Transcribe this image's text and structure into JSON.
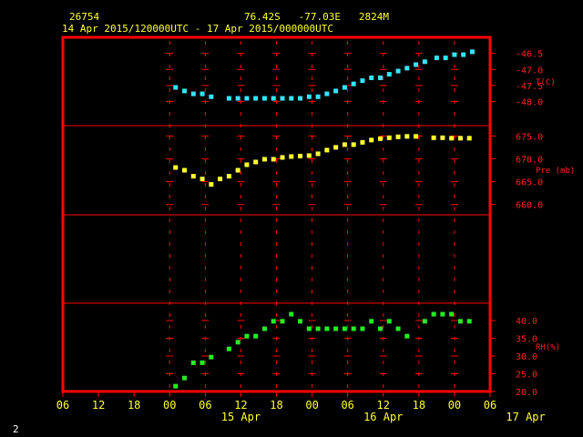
{
  "header": {
    "station": "26754",
    "location": "76.42S   -77.03E   2824M",
    "period": "14 Apr 2015/120000UTC - 17 Apr 2015/000000UTC"
  },
  "footer_label": "2",
  "colors": {
    "frame": "#ff0000",
    "axis_text": "#ffff33",
    "right_labels": "#ff2020",
    "temperature": "#33e5ff",
    "pressure": "#ffff33",
    "rh": "#22ee22",
    "background": "#000000"
  },
  "chart_data": [
    {
      "type": "scatter",
      "name": "temperature",
      "ylabel": "T(C)",
      "ylim": [
        -48.75,
        -46.0
      ],
      "yticks": [
        -46.5,
        -47.0,
        -47.5,
        -48.0
      ],
      "ytick_labels": [
        "-46.5",
        "-47.0",
        "-47.5",
        "-48.0"
      ],
      "x_hours": [
        13,
        14.5,
        16,
        17.5,
        19,
        22,
        23.5,
        25,
        26.5,
        28,
        29.5,
        31,
        32.5,
        34,
        35.5,
        37,
        38.5,
        40,
        41.5,
        43,
        44.5,
        46,
        47.5,
        49,
        50.5,
        52,
        53.5,
        55,
        57,
        58.5,
        60,
        61.5,
        63
      ],
      "values": [
        -47.56,
        -47.67,
        -47.76,
        -47.76,
        -47.85,
        -47.9,
        -47.9,
        -47.9,
        -47.9,
        -47.9,
        -47.9,
        -47.9,
        -47.9,
        -47.9,
        -47.85,
        -47.85,
        -47.76,
        -47.67,
        -47.56,
        -47.45,
        -47.35,
        -47.26,
        -47.26,
        -47.15,
        -47.05,
        -46.96,
        -46.85,
        -46.76,
        -46.64,
        -46.64,
        -46.54,
        -46.54,
        -46.45
      ]
    },
    {
      "type": "scatter",
      "name": "pressure",
      "ylabel": "Pre (mb)",
      "ylim": [
        657.75,
        677.25
      ],
      "yticks": [
        675.0,
        670.0,
        665.0,
        660.0
      ],
      "ytick_labels": [
        "675.0",
        "670.0",
        "665.0",
        "660.0"
      ],
      "x_hours": [
        13,
        14.5,
        16,
        17.5,
        19,
        20.5,
        22,
        23.5,
        25,
        26.5,
        28,
        29.5,
        31,
        32.5,
        34,
        35.5,
        37,
        38.5,
        40,
        41.5,
        43,
        44.5,
        46,
        47.5,
        49,
        50.5,
        52,
        53.5,
        56.5,
        58,
        59.5,
        61,
        62.5
      ],
      "values": [
        668.1,
        667.5,
        666.2,
        665.6,
        664.4,
        665.6,
        666.2,
        667.5,
        668.7,
        669.3,
        669.9,
        669.9,
        670.3,
        670.5,
        670.6,
        670.7,
        671.1,
        671.9,
        672.5,
        673.1,
        673.1,
        673.6,
        674.1,
        674.4,
        674.6,
        674.8,
        674.9,
        674.9,
        674.6,
        674.6,
        674.5,
        674.5,
        674.5
      ]
    },
    {
      "type": "scatter",
      "name": "rh",
      "ylabel": "RH(%)",
      "ylim": [
        20.0,
        44.9
      ],
      "yticks": [
        40.0,
        35.0,
        30.0,
        25.0,
        20.0
      ],
      "ytick_labels": [
        "40.0",
        "35.0",
        "30.0",
        "25.0",
        "20.0"
      ],
      "x_hours": [
        13,
        14.5,
        16,
        17.5,
        19,
        22,
        23.5,
        25,
        26.5,
        28,
        29.5,
        31,
        32.5,
        34,
        35.5,
        37,
        38.5,
        40,
        41.5,
        43,
        44.5,
        46,
        47.5,
        49,
        50.5,
        52,
        55,
        56.5,
        58,
        59.5,
        61,
        62.5
      ],
      "values": [
        21.5,
        23.8,
        28.1,
        28.1,
        29.7,
        32.0,
        33.9,
        35.6,
        35.6,
        37.7,
        39.8,
        39.8,
        41.8,
        39.8,
        37.7,
        37.7,
        37.7,
        37.7,
        37.7,
        37.7,
        37.7,
        39.8,
        37.7,
        39.8,
        37.7,
        35.6,
        39.8,
        41.8,
        41.8,
        41.8,
        39.8,
        39.8
      ]
    }
  ],
  "x_axis": {
    "range_hours": [
      -6,
      66
    ],
    "tick_hours": [
      -6,
      0,
      6,
      12,
      18,
      24,
      30,
      36,
      42,
      48,
      54,
      60,
      66
    ],
    "tick_labels": [
      "06",
      "12",
      "18",
      "00",
      "06",
      "12",
      "18",
      "00",
      "06",
      "12",
      "18",
      "00",
      "06"
    ],
    "date_labels": [
      {
        "hour": 24,
        "text": "15 Apr"
      },
      {
        "hour": 48,
        "text": "16 Apr"
      },
      {
        "hour": 72,
        "text": "17 Apr"
      }
    ]
  }
}
